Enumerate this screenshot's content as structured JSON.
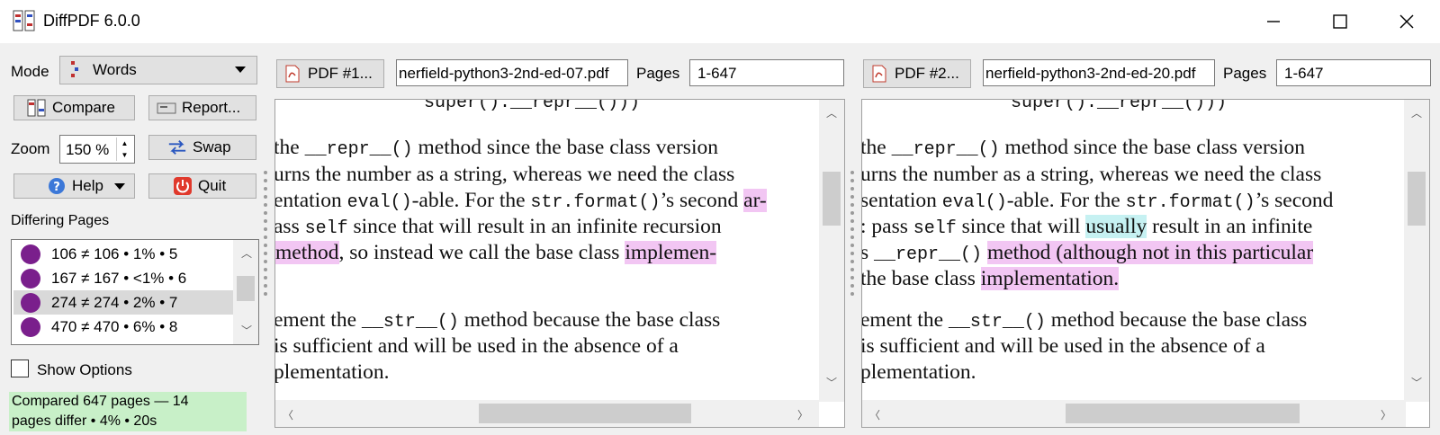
{
  "window": {
    "title": "DiffPDF 6.0.0"
  },
  "sidebar": {
    "mode_label": "Mode",
    "mode_value": "Words",
    "compare_label": "Compare",
    "report_label": "Report...",
    "zoom_label": "Zoom",
    "zoom_value": "150 %",
    "swap_label": "Swap",
    "help_label": "Help",
    "quit_label": "Quit",
    "differing_pages_label": "Differing Pages",
    "differing_pages": [
      {
        "text": "106 ≠ 106 • 1% • 5",
        "selected": false
      },
      {
        "text": "167 ≠ 167 • <1% • 6",
        "selected": false
      },
      {
        "text": "274 ≠ 274 • 2% • 7",
        "selected": true
      },
      {
        "text": "470 ≠ 470 • 6% • 8",
        "selected": false
      }
    ],
    "show_options_label": "Show Options",
    "show_options_checked": false,
    "status_line1": "Compared 647 pages — 14",
    "status_line2": "pages differ • 4% • 20s"
  },
  "pdf1": {
    "button_label": "PDF #1...",
    "filename": "nerfield-python3-2nd-ed-07.pdf",
    "pages_label": "Pages",
    "pages_value": "1-647"
  },
  "pdf2": {
    "button_label": "PDF #2...",
    "filename": "nerfield-python3-2nd-ed-20.pdf",
    "pages_label": "Pages",
    "pages_value": "1-647"
  },
  "left_doc": {
    "top_code": "super().__repr__()))",
    "l1_a": "the ",
    "l1_code": "__repr__()",
    "l1_b": " method since the base class version",
    "l2": "urns the number as a string, whereas we need the class",
    "l3_a": "entation ",
    "l3_code": "eval()",
    "l3_b": "-able.  For the ",
    "l3_code2": "str.format()",
    "l3_c": "’s second ",
    "l3_hl": "ar-",
    "l4_a": "ass ",
    "l4_code": "self",
    "l4_b": " since that will result in an infinite recursion",
    "l5_hl": " method",
    "l5_a": ", so instead we call the base class ",
    "l5_hl2": "implemen-",
    "l6_a": "ement the ",
    "l6_code": "__str__()",
    "l6_b": " method because the base class",
    "l7": " is sufficient and will be used in the absence of a",
    "l8": "plementation."
  },
  "right_doc": {
    "top_code": "super().__repr__()))",
    "l1_a": "the ",
    "l1_code": "__repr__()",
    "l1_b": " method since the base class version",
    "l2": "urns the number as a string, whereas we need the class",
    "l3_a": "sentation ",
    "l3_code": "eval()",
    "l3_b": "-able.  For the ",
    "l3_code2": "str.format()",
    "l3_c": "’s second",
    "l4_a": ": pass ",
    "l4_code": "self",
    "l4_b": " since that will ",
    "l4_hl": "usually",
    "l4_c": " result in an infinite",
    "l5_a": "s ",
    "l5_code": "__repr__()",
    "l5_b": " ",
    "l5_hl": "method (although not in this particular",
    "l6_a": "the base class ",
    "l6_hl": "implementation.",
    "l7_a": "ement the ",
    "l7_code": "__str__()",
    "l7_b": " method because the base class",
    "l8": " is sufficient and will be used in the absence of a",
    "l9": "plementation."
  },
  "colors": {
    "diff_highlight": "#f2c6f3",
    "added_highlight": "#c6f1f2",
    "status_background": "#c8f0c8",
    "page_indicator": "#7a1f8c"
  }
}
